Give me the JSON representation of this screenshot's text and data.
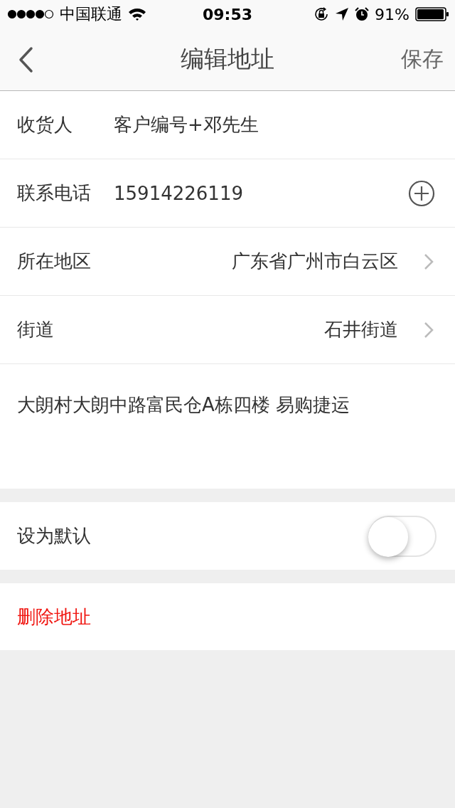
{
  "status_bar": {
    "carrier": "中国联通",
    "time": "09:53",
    "battery": "91%"
  },
  "nav": {
    "title": "编辑地址",
    "action": "保存"
  },
  "fields": [
    {
      "kind": "text",
      "label": "收货人",
      "value": "客户编号+邓先生"
    },
    {
      "kind": "phone",
      "label": "联系电话",
      "value": "15914226119"
    },
    {
      "kind": "select",
      "label": "所在地区",
      "value": "广东省广州市白云区"
    },
    {
      "kind": "select",
      "label": "街道",
      "value": "石井街道"
    }
  ],
  "address": {
    "value": "大朗村大朗中路富民仓A栋四楼 易购捷运"
  },
  "default_setting": {
    "label": "设为默认",
    "on": false
  },
  "delete_button": "删除地址"
}
